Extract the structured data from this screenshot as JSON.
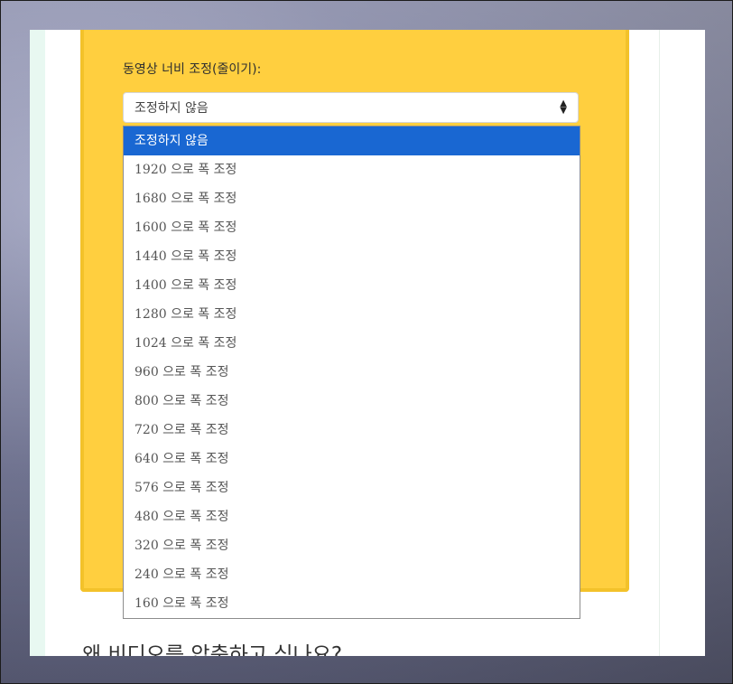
{
  "field": {
    "label": "동영상 너비 조정(줄이기):",
    "selected_value": "조정하지 않음"
  },
  "dropdown": {
    "options": [
      "조정하지 않음",
      "1920 으로 폭 조정",
      "1680 으로 폭 조정",
      "1600 으로 폭 조정",
      "1440 으로 폭 조정",
      "1400 으로 폭 조정",
      "1280 으로 폭 조정",
      "1024 으로 폭 조정",
      "960 으로 폭 조정",
      "800 으로 폭 조정",
      "720 으로 폭 조정",
      "640 으로 폭 조정",
      "576 으로 폭 조정",
      "480 으로 폭 조정",
      "320 으로 폭 조정",
      "240 으로 폭 조정",
      "160 으로 폭 조정"
    ],
    "selected_index": 0
  },
  "section": {
    "heading": "왜 비디오를 압축하고 싶나요?"
  },
  "colors": {
    "card_background": "#ffcf3f",
    "card_border": "#f3c22a",
    "selected_option": "#1967d2",
    "left_strip": "#e8f8f1"
  },
  "icons": {
    "select_arrow": "sort-arrows-icon"
  }
}
